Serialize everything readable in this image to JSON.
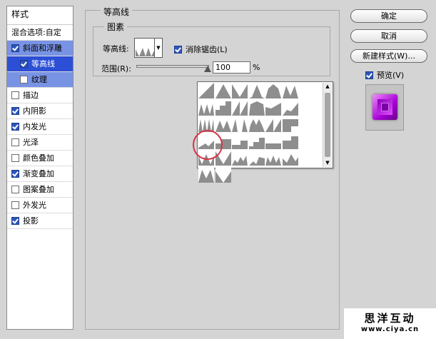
{
  "left_panel": {
    "title": "样式",
    "items": [
      {
        "label": "混合选项:自定",
        "checkbox": false
      },
      {
        "label": "斜面和浮雕",
        "checkbox": true,
        "checked": true
      },
      {
        "label": "等高线",
        "checkbox": true,
        "checked": true
      },
      {
        "label": "纹理",
        "checkbox": true,
        "checked": false
      },
      {
        "label": "描边",
        "checkbox": true,
        "checked": false
      },
      {
        "label": "内阴影",
        "checkbox": true,
        "checked": true
      },
      {
        "label": "内发光",
        "checkbox": true,
        "checked": true
      },
      {
        "label": "光泽",
        "checkbox": true,
        "checked": false
      },
      {
        "label": "颜色叠加",
        "checkbox": true,
        "checked": false
      },
      {
        "label": "渐变叠加",
        "checkbox": true,
        "checked": true
      },
      {
        "label": "图案叠加",
        "checkbox": true,
        "checked": false
      },
      {
        "label": "外发光",
        "checkbox": true,
        "checked": false
      },
      {
        "label": "投影",
        "checkbox": true,
        "checked": true
      }
    ]
  },
  "main": {
    "group_title": "等高线",
    "subgroup_title": "图素",
    "contour_label": "等高线:",
    "antialias_label": "消除锯齿(L)",
    "antialias_checked": true,
    "range_label": "范围(R):",
    "range_value": "100",
    "range_unit": "%",
    "range_fraction": 0.95
  },
  "buttons": {
    "ok": "确定",
    "cancel": "取消",
    "new_style": "新建样式(W)..."
  },
  "preview": {
    "label": "预览(V)",
    "checked": true
  },
  "watermark": {
    "title": "思洋互动",
    "url": "www.ciya.cn"
  },
  "colors": {
    "selected_row": "#2c4fd6",
    "parent_row": "#7993e4",
    "highlight_circle": "#d73346",
    "gem": "#b400e0"
  },
  "contour_presets": [
    "linear",
    "cone",
    "cone-inverted",
    "gaussian",
    "half-round",
    "ring",
    "ring-double",
    "rounded-steps",
    "sawtooth",
    "cove-deep",
    "cove-shallow",
    "rolling-slope",
    "peaks",
    "triangle-multi",
    "spike-pair",
    "double-ring",
    "sawtooth-2",
    "notch",
    "ramps",
    "step-1",
    "step-2",
    "step-3",
    "step-4",
    "step-5",
    "w-shape",
    "triangle-inv",
    "wave-a",
    "wave-b",
    "wave-c",
    "wave-d",
    "m-shape",
    "v-shape"
  ]
}
